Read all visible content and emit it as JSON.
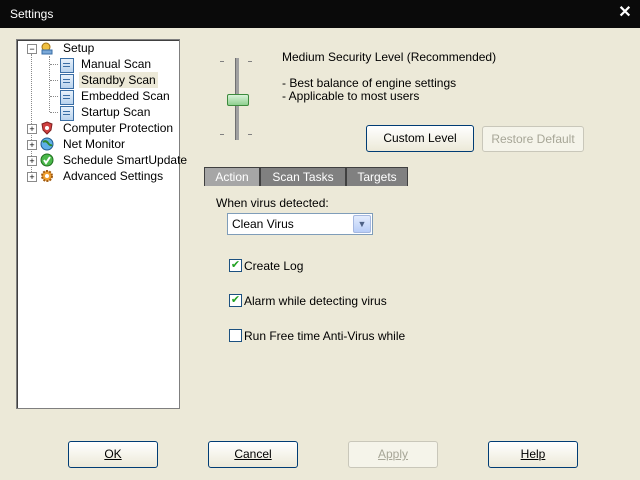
{
  "window": {
    "title": "Settings",
    "close_glyph": "✕"
  },
  "tree": {
    "items": [
      {
        "label": "Setup",
        "icon": "setup-icon"
      },
      {
        "label": "Manual Scan",
        "icon": "document-icon"
      },
      {
        "label": "Standby Scan",
        "icon": "document-icon",
        "selected": true
      },
      {
        "label": "Embedded Scan",
        "icon": "document-icon"
      },
      {
        "label": "Startup Scan",
        "icon": "document-icon"
      },
      {
        "label": "Computer Protection",
        "icon": "shield-icon"
      },
      {
        "label": "Net Monitor",
        "icon": "globe-icon"
      },
      {
        "label": "Schedule SmartUpdate",
        "icon": "update-check-icon"
      },
      {
        "label": "Advanced Settings",
        "icon": "gear-icon"
      }
    ],
    "expand_minus": "−",
    "expand_plus": "+"
  },
  "security": {
    "level_title": "Medium Security Level (Recommended)",
    "line1": "- Best balance of engine settings",
    "line2": "- Applicable to most users",
    "level_value": "Medium",
    "custom_button": "Custom Level",
    "restore_button": "Restore Default"
  },
  "tabs": [
    {
      "label": "Action",
      "active": true
    },
    {
      "label": "Scan Tasks"
    },
    {
      "label": "Targets"
    }
  ],
  "action": {
    "when_label": "When virus detected:",
    "select_value": "Clean Virus",
    "checkboxes": [
      {
        "label": "Create Log",
        "checked": true
      },
      {
        "label": "Alarm while detecting virus",
        "checked": true
      },
      {
        "label": "Run Free time Anti-Virus while syste",
        "checked": false
      }
    ],
    "check_glyph": "✔"
  },
  "footer": {
    "ok": "OK",
    "cancel": "Cancel",
    "apply": "Apply",
    "help": "Help"
  },
  "colors": {
    "titlebar": "#0a0a0a",
    "dialog_bg": "#ece9d8",
    "button_border": "#003c74"
  }
}
